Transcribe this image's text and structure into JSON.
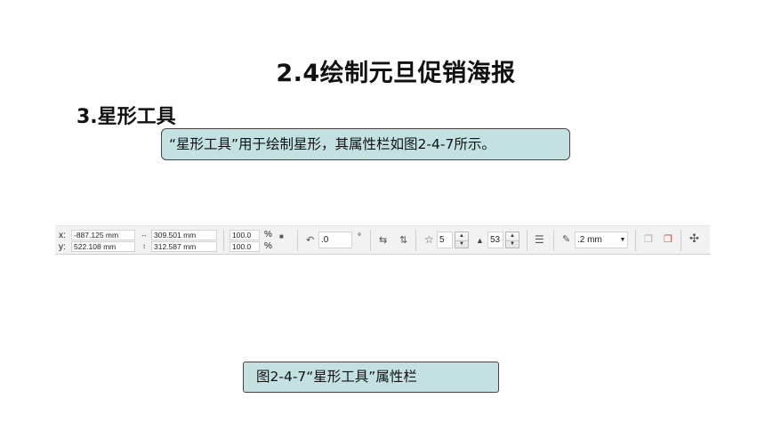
{
  "slide": {
    "title": "2.4绘制元旦促销海报",
    "section": "3.星形工具",
    "callout": "“星形工具”用于绘制星形，其属性栏如图2-4-7所示。",
    "caption": "图2-4-7“星形工具”属性栏"
  },
  "toolbar": {
    "x_label": "x:",
    "x_value": "-887.125 mm",
    "y_label": "y:",
    "y_value": "522.108 mm",
    "width_value": "309.501 mm",
    "height_value": "312.587 mm",
    "scale_x": "100.0",
    "scale_y": "100.0",
    "percent": "%",
    "rotation_value": ".0",
    "degree": "°",
    "points_value": "5",
    "sharpness_value": "53",
    "outline_value": ".2 mm"
  },
  "icons": {
    "width": "width-arrows-icon",
    "height": "height-arrows-icon",
    "lock": "lock-icon",
    "rotate": "rotate-icon",
    "mirror_h": "mirror-horizontal-icon",
    "mirror_v": "mirror-vertical-icon",
    "star": "star-icon",
    "sharpness": "triangle-sharpness-icon",
    "wrap": "text-wrap-icon",
    "pen": "outline-pen-icon",
    "front": "to-front-icon",
    "back": "to-back-icon",
    "convert": "convert-curve-icon"
  }
}
